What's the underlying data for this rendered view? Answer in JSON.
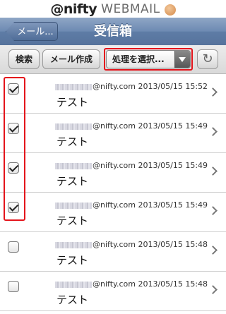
{
  "brand": {
    "name": "@nifty",
    "product": "WEBMAIL"
  },
  "navbar": {
    "back_label": "メール...",
    "title": "受信箱"
  },
  "toolbar": {
    "search_label": "検索",
    "compose_label": "メール作成",
    "action_select_value": "処理を選択...",
    "refresh_icon": "refresh-icon"
  },
  "messages": [
    {
      "sender_domain": "@nifty.com",
      "date": "2013/05/15 15:52",
      "subject": "テスト",
      "checked": true
    },
    {
      "sender_domain": "@nifty.com",
      "date": "2013/05/15 15:49",
      "subject": "テスト",
      "checked": true
    },
    {
      "sender_domain": "@nifty.com",
      "date": "2013/05/15 15:49",
      "subject": "テスト",
      "checked": true
    },
    {
      "sender_domain": "@nifty.com",
      "date": "2013/05/15 15:49",
      "subject": "テスト",
      "checked": true
    },
    {
      "sender_domain": "@nifty.com",
      "date": "2013/05/15 15:48",
      "subject": "テスト",
      "checked": false
    },
    {
      "sender_domain": "@nifty.com",
      "date": "2013/05/15 15:48",
      "subject": "テスト",
      "checked": false
    }
  ],
  "colors": {
    "navbar": "#6d8ab2",
    "highlight": "#e4141b"
  }
}
